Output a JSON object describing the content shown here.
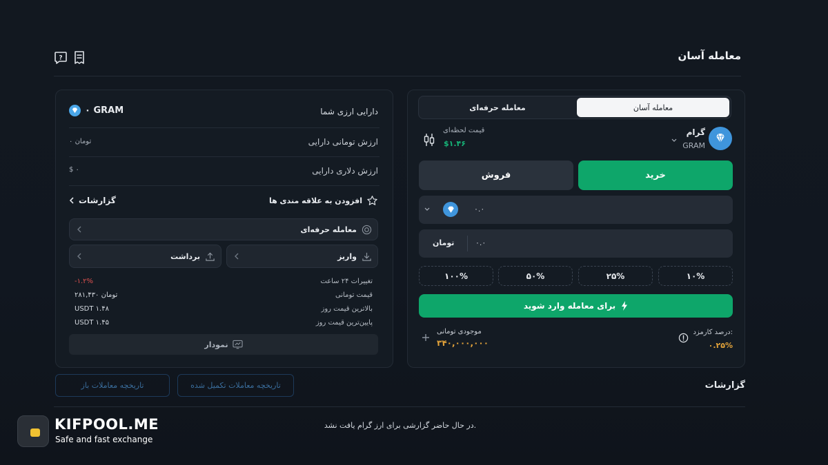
{
  "header": {
    "title": "معامله آسان"
  },
  "assets": {
    "title": "دارایی ارزی شما",
    "gram_balance": "۰ GRAM",
    "toman_value_label": "ارزش تومانی دارایی",
    "toman_value": "۰ تومان",
    "dollar_value_label": "ارزش دلاری دارایی",
    "dollar_value": "$ ۰",
    "reports_link": "گزارشات",
    "favorites": "افزودن به علاقه مندی ها",
    "pro_trade": "معامله حرفه‌ای",
    "deposit": "واریز",
    "withdraw": "برداشت",
    "stats": [
      {
        "label": "تغییرات ۲۴ ساعت",
        "value": "-۱.۲%"
      },
      {
        "label": "قیمت تومانی",
        "value": "۲۸۱,۴۳۰ تومان"
      },
      {
        "label": "بالاترین قیمت روز",
        "value": "USDT ۱.۴۸"
      },
      {
        "label": "پایین‌ترین قیمت روز",
        "value": "USDT ۱.۴۵"
      }
    ],
    "chart_button": "نمودار"
  },
  "trade": {
    "tab_easy": "معامله آسان",
    "tab_pro": "معامله حرفه‌ای",
    "coin_name": "گرام",
    "coin_symbol": "GRAM",
    "price_label": "قیمت لحظه‌ای",
    "price_value": "$۱.۴۶",
    "buy": "خرید",
    "sell": "فروش",
    "amount_value": "۰.۰",
    "toman_value": "۰.۰",
    "toman_label": "تومان",
    "percents": [
      "۱۰%",
      "۲۵%",
      "۵۰%",
      "۱۰۰%"
    ],
    "enter_button": "برای معامله وارد شوید",
    "fee_label": "درصد کارمزد:",
    "fee_value": "۰.۲۵%",
    "balance_label": "موجودی تومانی",
    "balance_value": "۳۴۰,۰۰۰,۰۰۰"
  },
  "reports": {
    "title": "گزارشات",
    "tab_completed": "تاریخچه معاملات تکمیل شده",
    "tab_open": "تاریخچه معاملات باز",
    "empty": "در حال حاضر گزارشی برای ارز گرام یافت نشد."
  },
  "brand": {
    "name": "KIFPOOL.ME",
    "tagline": "Safe and fast exchange"
  },
  "colors": {
    "accent_green": "#0ea66a",
    "negative": "#e0524f",
    "fee_orange": "#e3a33a"
  }
}
